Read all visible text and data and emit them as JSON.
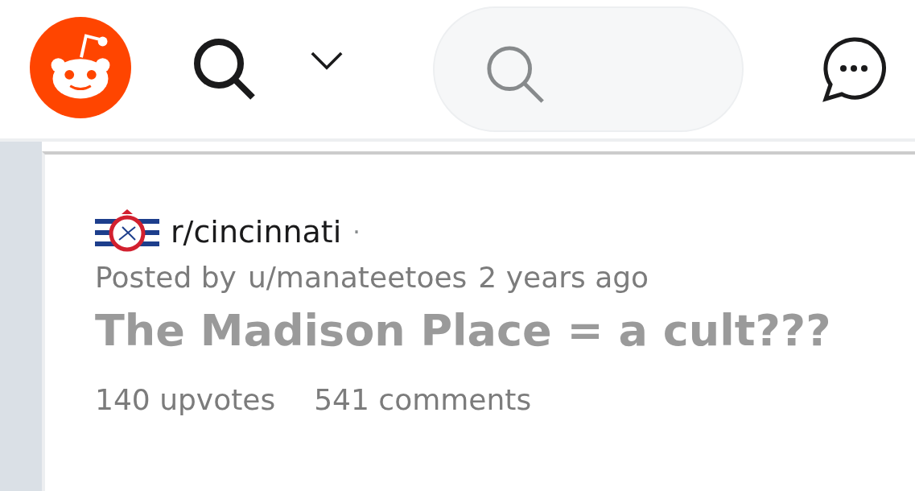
{
  "post": {
    "subreddit": "r/cincinnati",
    "separator": "·",
    "posted_by_label": "Posted by",
    "author": "u/manateetoes",
    "time": "2 years ago",
    "title": "The Madison Place = a cult???",
    "upvotes": "140 upvotes",
    "comments": "541 comments"
  }
}
